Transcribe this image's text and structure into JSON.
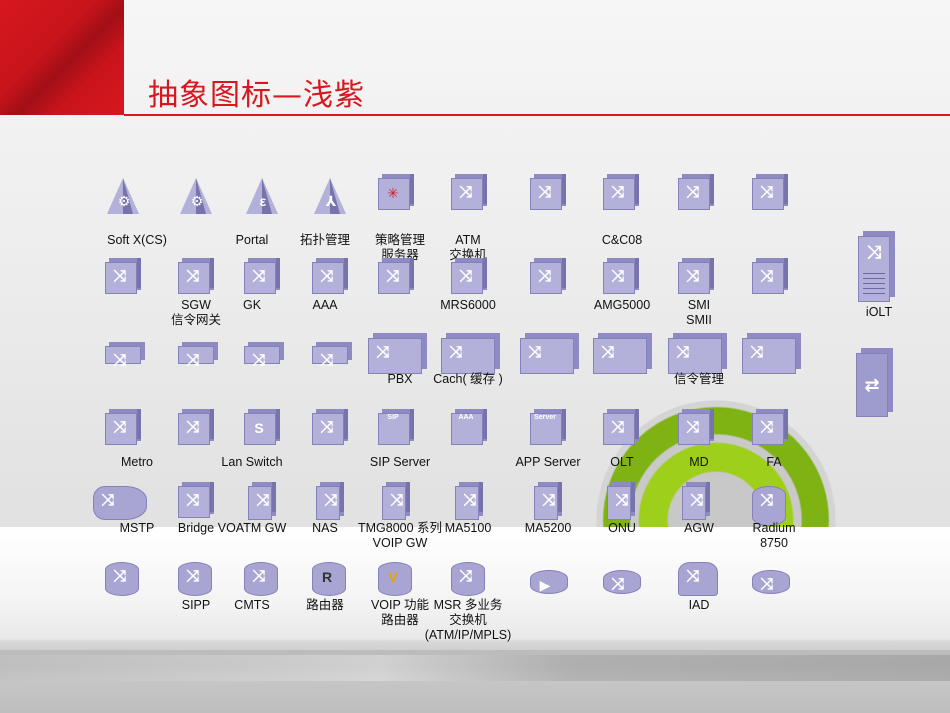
{
  "slide": {
    "title": "抽象图标—浅紫",
    "colors": {
      "accent_red": "#d8171f",
      "icon_fill": "#b3b0d9",
      "icon_side": "#7673ad",
      "orb_green": "#9ecf1a"
    }
  },
  "rows": [
    {
      "items": [
        {
          "icon": "softx-triangle-gears-icon",
          "label": "Soft X(CS)"
        },
        {
          "icon": "triangle-gears-icon",
          "label": ""
        },
        {
          "icon": "portal-triangle-icon",
          "label": "Portal"
        },
        {
          "icon": "topology-triangle-icon",
          "label": "拓扑管理"
        },
        {
          "icon": "policy-server-cube-icon",
          "label": "策略管理\n服务器"
        },
        {
          "icon": "atm-switch-cube-icon",
          "label": "ATM\n交换机"
        },
        {
          "icon": "router-cube-icon",
          "label": ""
        },
        {
          "icon": "cc08-cube-icon",
          "label": "C&C08"
        },
        {
          "icon": "crossover-cube-icon",
          "label": ""
        },
        {
          "icon": "loop-cube-icon",
          "label": ""
        }
      ]
    },
    {
      "items": [
        {
          "icon": "loop-cube-icon",
          "label": ""
        },
        {
          "icon": "sgw-cube-icon",
          "label": "SGW\n信令网关"
        },
        {
          "icon": "gk-cube-icon",
          "label": "GK"
        },
        {
          "icon": "aaa-cube-icon",
          "label": "AAA"
        },
        {
          "icon": "exchange-cube-icon",
          "label": ""
        },
        {
          "icon": "mrs-cube-icon",
          "label": "MRS6000"
        },
        {
          "icon": "fanout-cube-icon",
          "label": ""
        },
        {
          "icon": "amg-cube-icon",
          "label": "AMG5000"
        },
        {
          "icon": "smi-cube-icon",
          "label": "SMI\nSMII"
        },
        {
          "icon": "branch-cube-icon",
          "label": ""
        }
      ]
    },
    {
      "items": [
        {
          "icon": "flat-switch-icon",
          "label": ""
        },
        {
          "icon": "flat-crossbar-icon",
          "label": ""
        },
        {
          "icon": "flat-loop-icon",
          "label": ""
        },
        {
          "icon": "flat-fanout-icon",
          "label": ""
        },
        {
          "icon": "pbx-icon",
          "label": "PBX"
        },
        {
          "icon": "cache-icon",
          "label": "Cach( 缓存 )"
        },
        {
          "icon": "cloud-fanout-icon",
          "label": ""
        },
        {
          "icon": "fanout-wide-icon",
          "label": ""
        },
        {
          "icon": "signal-mgmt-icon",
          "label": "信令管理"
        },
        {
          "icon": "bidirectional-icon",
          "label": ""
        }
      ]
    },
    {
      "items": [
        {
          "icon": "metro-icon",
          "label": "Metro"
        },
        {
          "icon": "switch-box-icon",
          "label": ""
        },
        {
          "icon": "lan-switch-icon",
          "label": "Lan Switch"
        },
        {
          "icon": "storage-box-icon",
          "label": ""
        },
        {
          "icon": "sip-server-icon",
          "label": "SIP Server",
          "tag": "SIP"
        },
        {
          "icon": "aaa-server-icon",
          "label": "",
          "tag": "AAA"
        },
        {
          "icon": "app-server-icon",
          "label": "APP Server",
          "tag": "Server"
        },
        {
          "icon": "olt-icon",
          "label": "OLT"
        },
        {
          "icon": "md-icon",
          "label": "MD"
        },
        {
          "icon": "fa-icon",
          "label": "FA"
        }
      ]
    },
    {
      "items": [
        {
          "icon": "mstp-icon",
          "label": "MSTP"
        },
        {
          "icon": "bridge-icon",
          "label": "Bridge"
        },
        {
          "icon": "voatm-gw-icon",
          "label": "VOATM GW"
        },
        {
          "icon": "nas-icon",
          "label": "NAS"
        },
        {
          "icon": "tmg-icon",
          "label": "TMG8000 系列\nVOIP GW"
        },
        {
          "icon": "ma5100-icon",
          "label": "MA5100"
        },
        {
          "icon": "ma5200-icon",
          "label": "MA5200"
        },
        {
          "icon": "onu-icon",
          "label": "ONU"
        },
        {
          "icon": "agw-icon",
          "label": "AGW"
        },
        {
          "icon": "radium-icon",
          "label": "Radium\n8750"
        }
      ]
    },
    {
      "items": [
        {
          "icon": "media-cylinder-icon",
          "label": ""
        },
        {
          "icon": "sipp-icon",
          "label": "SIPP"
        },
        {
          "icon": "cmts-icon",
          "label": "CMTS"
        },
        {
          "icon": "router-icon",
          "label": "路由器"
        },
        {
          "icon": "voip-router-icon",
          "label": "VOIP 功能\n路由器"
        },
        {
          "icon": "msr-icon",
          "label": "MSR 多业务\n交换机\n(ATM/IP/MPLS)"
        },
        {
          "icon": "play-cylinder-icon",
          "label": ""
        },
        {
          "icon": "router-flat-icon",
          "label": ""
        },
        {
          "icon": "iad-icon",
          "label": "IAD"
        },
        {
          "icon": "hex-switch-icon",
          "label": ""
        }
      ]
    }
  ],
  "side": [
    {
      "icon": "iolt-tower-icon",
      "label": "iOLT"
    },
    {
      "icon": "loopback-tower-icon",
      "label": ""
    }
  ]
}
